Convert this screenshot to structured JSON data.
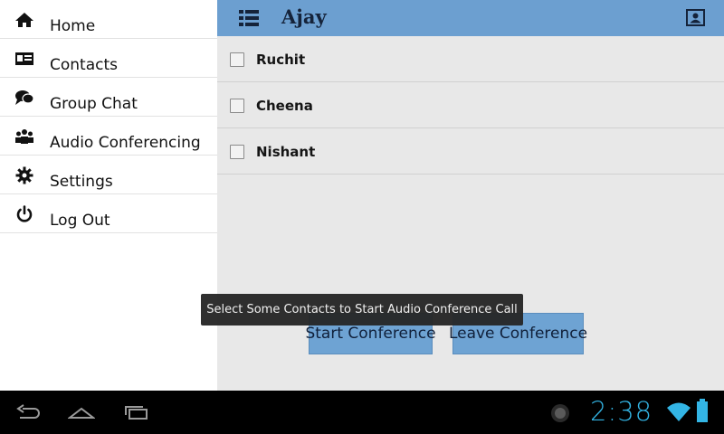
{
  "drawer": {
    "items": [
      {
        "label": "Home",
        "icon": "home-icon"
      },
      {
        "label": "Contacts",
        "icon": "contact-card-icon"
      },
      {
        "label": "Group Chat",
        "icon": "chat-bubbles-icon"
      },
      {
        "label": "Audio Conferencing",
        "icon": "group-people-icon"
      },
      {
        "label": "Settings",
        "icon": "gear-icon"
      },
      {
        "label": "Log Out",
        "icon": "power-icon"
      }
    ]
  },
  "appbar": {
    "title": "Ajay",
    "menu_icon": "list-menu-icon",
    "contact_icon": "contact-badge-icon",
    "color": "#6c9fd0"
  },
  "contacts": [
    {
      "name": "Ruchit",
      "checked": false
    },
    {
      "name": "Cheena",
      "checked": false
    },
    {
      "name": "Nishant",
      "checked": false
    }
  ],
  "buttons": {
    "start_label": "Start Conference",
    "leave_label": "Leave Conference"
  },
  "toast": {
    "message": "Select Some Contacts to Start Audio Conference Call"
  },
  "system_bar": {
    "clock": "2:38",
    "accent": "#33b5e5",
    "icons": [
      "back-icon",
      "home-icon",
      "recents-icon",
      "notification-icon",
      "wifi-icon",
      "battery-icon"
    ]
  }
}
